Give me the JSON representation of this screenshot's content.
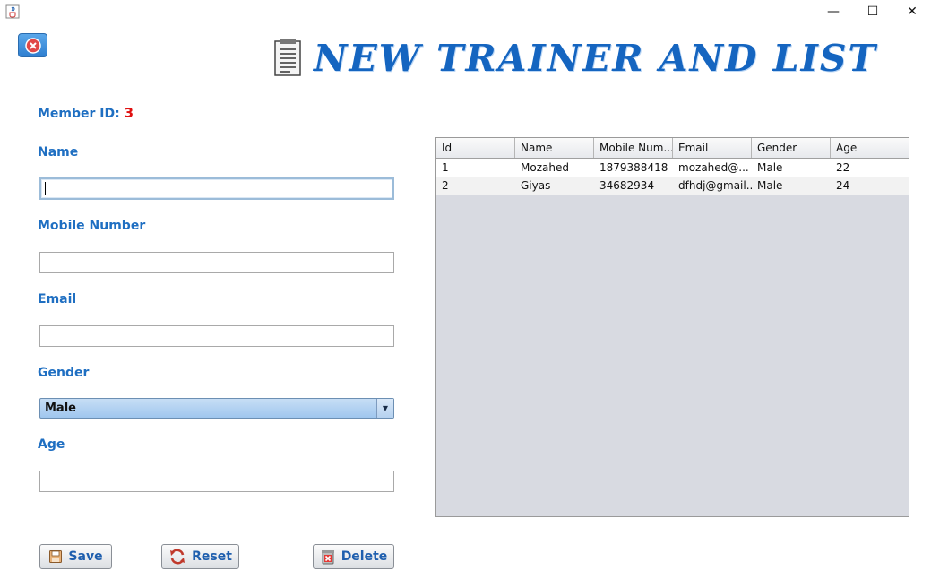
{
  "window": {
    "minimize_glyph": "—",
    "maximize_glyph": "☐",
    "close_glyph": "✕"
  },
  "header": {
    "title": "NEW TRAINER AND LIST",
    "title_icon": "document-list-icon",
    "close_icon": "close-icon"
  },
  "form": {
    "member_id_label": "Member ID:",
    "member_id_value": "3",
    "name_label": "Name",
    "name_value": "",
    "mobile_label": "Mobile Number",
    "mobile_value": "",
    "email_label": "Email",
    "email_value": "",
    "gender_label": "Gender",
    "gender_value": "Male",
    "age_label": "Age",
    "age_value": ""
  },
  "buttons": {
    "save": "Save",
    "reset": "Reset",
    "delete": "Delete"
  },
  "table": {
    "columns": [
      "Id",
      "Name",
      "Mobile Num...",
      "Email",
      "Gender",
      "Age"
    ],
    "rows": [
      [
        "1",
        "Mozahed",
        "1879388418",
        "mozahed@...",
        "Male",
        "22"
      ],
      [
        "2",
        "Giyas",
        "34682934",
        "dfhdj@gmail...",
        "Male",
        "24"
      ]
    ]
  },
  "colors": {
    "label": "#1f6fc2",
    "title": "#1565c0",
    "member_id": "#e01010"
  }
}
